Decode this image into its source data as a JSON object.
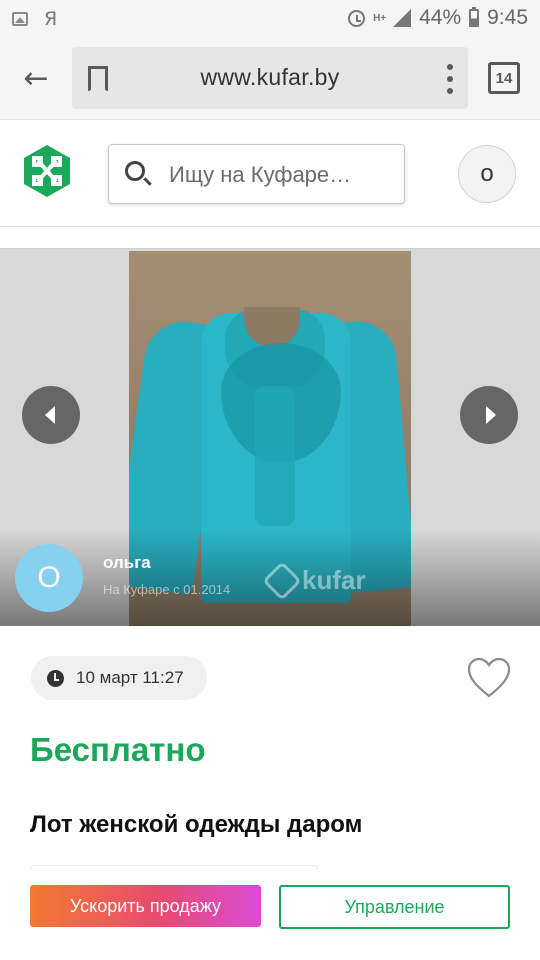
{
  "status_bar": {
    "left_icons": [
      "image-icon",
      "yandex-icon"
    ],
    "yandex_label": "Я",
    "battery": "44%",
    "time": "9:45",
    "network": "H+"
  },
  "browser": {
    "url": "www.kufar.by",
    "tabs_count": "14"
  },
  "header": {
    "search_placeholder": "Ищу на Куфаре…",
    "user_initial": "о",
    "brand_color": "#1ca85a"
  },
  "gallery": {
    "watermark": "kufar",
    "seller": {
      "initial": "О",
      "name": "ольга",
      "since": "На Куфаре с 01.2014"
    }
  },
  "listing": {
    "date": "10 март 11:27",
    "price": "Бесплатно",
    "title": "Лот женской одежды даром"
  },
  "actions": {
    "boost_label": "Ускорить продажу",
    "manage_label": "Управление"
  }
}
